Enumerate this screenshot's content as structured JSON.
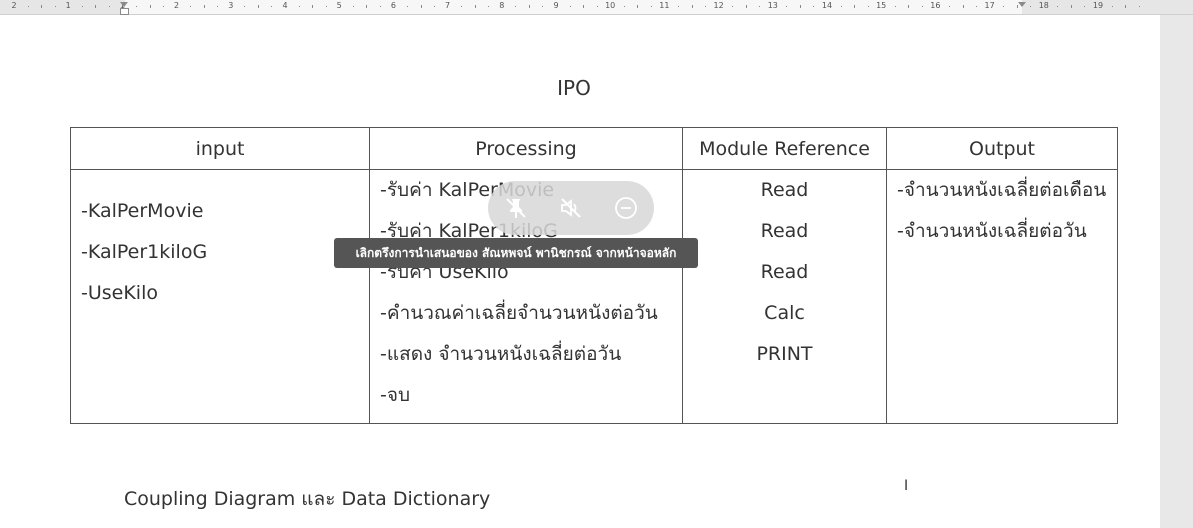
{
  "ruler": {
    "numbers": [
      "2",
      "1",
      "1",
      "2",
      "3",
      "4",
      "5",
      "6",
      "7",
      "8",
      "9",
      "10",
      "11",
      "12",
      "13",
      "14",
      "15",
      "16",
      "17",
      "18",
      "19"
    ]
  },
  "document": {
    "title": "IPO",
    "table": {
      "headers": [
        "input",
        "Processing",
        "Module Reference",
        "Output"
      ],
      "input": [
        "-KalPerMovie",
        "-KalPer1kiloG",
        "-UseKilo"
      ],
      "processing": [
        "-รับค่า  KalPerMovie",
        "-รับค่า  KalPer1kiloG",
        "-รับค่า  UseKilo",
        "-คำนวณค่าเฉลี่ยจำนวนหนังต่อวัน",
        "-แสดง จำนวนหนังเฉลี่ยต่อวัน",
        "-จบ"
      ],
      "module_reference": [
        "Read",
        "Read",
        "Read",
        "Calc",
        "PRINT"
      ],
      "output": [
        "-จำนวนหนังเฉลี่ยต่อเดือน",
        "-จำนวนหนังเฉลี่ยต่อวัน"
      ]
    },
    "section_heading": "Coupling Diagram และ Data Dictionary"
  },
  "overlay": {
    "tooltip": "เลิกตรึงการนำเสนอของ สัณหพจน์ พานิชกรณ์ จากหน้าจอหลัก",
    "icons": [
      "unpin-icon",
      "mute-audio-icon",
      "minimize-icon"
    ]
  }
}
